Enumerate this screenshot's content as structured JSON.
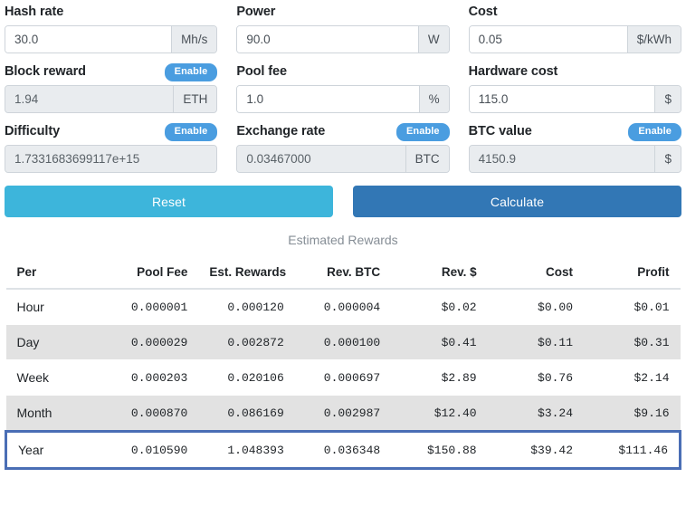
{
  "form": {
    "fields": [
      {
        "key": "hash_rate",
        "label": "Hash rate",
        "value": "30.0",
        "unit": "Mh/s",
        "disabled": false,
        "has_toggle": false,
        "toggle_label": ""
      },
      {
        "key": "power",
        "label": "Power",
        "value": "90.0",
        "unit": "W",
        "disabled": false,
        "has_toggle": false,
        "toggle_label": ""
      },
      {
        "key": "cost",
        "label": "Cost",
        "value": "0.05",
        "unit": "$/kWh",
        "disabled": false,
        "has_toggle": false,
        "toggle_label": ""
      },
      {
        "key": "block_reward",
        "label": "Block reward",
        "value": "1.94",
        "unit": "ETH",
        "disabled": true,
        "has_toggle": true,
        "toggle_label": "Enable"
      },
      {
        "key": "pool_fee",
        "label": "Pool fee",
        "value": "1.0",
        "unit": "%",
        "disabled": false,
        "has_toggle": false,
        "toggle_label": ""
      },
      {
        "key": "hardware_cost",
        "label": "Hardware cost",
        "value": "115.0",
        "unit": "$",
        "disabled": false,
        "has_toggle": false,
        "toggle_label": ""
      },
      {
        "key": "difficulty",
        "label": "Difficulty",
        "value": "1.7331683699117e+15",
        "unit": "",
        "disabled": true,
        "has_toggle": true,
        "toggle_label": "Enable"
      },
      {
        "key": "exchange_rate",
        "label": "Exchange rate",
        "value": "0.03467000",
        "unit": "BTC",
        "disabled": true,
        "has_toggle": true,
        "toggle_label": "Enable"
      },
      {
        "key": "btc_value",
        "label": "BTC value",
        "value": "4150.9",
        "unit": "$",
        "disabled": true,
        "has_toggle": true,
        "toggle_label": "Enable"
      }
    ]
  },
  "actions": {
    "reset_label": "Reset",
    "calculate_label": "Calculate"
  },
  "results": {
    "caption": "Estimated Rewards",
    "columns": [
      "Per",
      "Pool Fee",
      "Est. Rewards",
      "Rev. BTC",
      "Rev. $",
      "Cost",
      "Profit"
    ],
    "rows": [
      {
        "cells": [
          "Hour",
          "0.000001",
          "0.000120",
          "0.000004",
          "$0.02",
          "$0.00",
          "$0.01"
        ],
        "striped": false,
        "highlight": false
      },
      {
        "cells": [
          "Day",
          "0.000029",
          "0.002872",
          "0.000100",
          "$0.41",
          "$0.11",
          "$0.31"
        ],
        "striped": true,
        "highlight": false
      },
      {
        "cells": [
          "Week",
          "0.000203",
          "0.020106",
          "0.000697",
          "$2.89",
          "$0.76",
          "$2.14"
        ],
        "striped": false,
        "highlight": false
      },
      {
        "cells": [
          "Month",
          "0.000870",
          "0.086169",
          "0.002987",
          "$12.40",
          "$3.24",
          "$9.16"
        ],
        "striped": true,
        "highlight": false
      },
      {
        "cells": [
          "Year",
          "0.010590",
          "1.048393",
          "0.036348",
          "$150.88",
          "$39.42",
          "$111.46"
        ],
        "striped": false,
        "highlight": true
      }
    ]
  },
  "colors": {
    "badge_blue": "#4a9de0",
    "reset_cyan": "#3db5db",
    "calculate_blue": "#3277b5",
    "highlight_border": "#4a6eb5",
    "disabled_grey": "#e9ecef",
    "stripe_grey": "#e2e2e2",
    "muted_text": "#868e96"
  }
}
